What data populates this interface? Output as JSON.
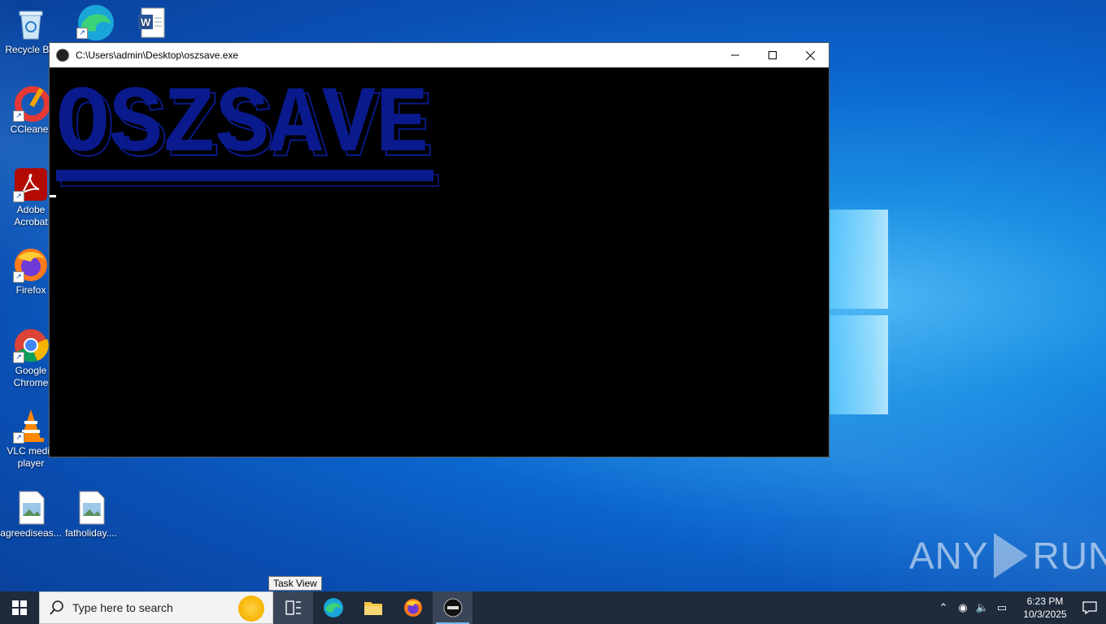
{
  "desktop": {
    "icons": [
      {
        "label": "Recycle Bin"
      },
      {
        "label": "CCleaner"
      },
      {
        "label": "Adobe\nAcrobat"
      },
      {
        "label": "Firefox"
      },
      {
        "label": "Google\nChrome"
      },
      {
        "label": "VLC media\nplayer"
      },
      {
        "label": "agreediseas..."
      },
      {
        "label": "fatholiday...."
      }
    ]
  },
  "console": {
    "title": "C:\\Users\\admin\\Desktop\\oszsave.exe",
    "banner_text": "OSZSAVE",
    "banner_color": "#0a1a8c",
    "background": "#000000"
  },
  "tooltip": {
    "text": "Task View"
  },
  "taskbar": {
    "search_placeholder": "Type here to search",
    "clock_time": "6:23 PM",
    "clock_date": "10/3/2025"
  },
  "watermark": {
    "left": "ANY",
    "right": "RUN"
  }
}
